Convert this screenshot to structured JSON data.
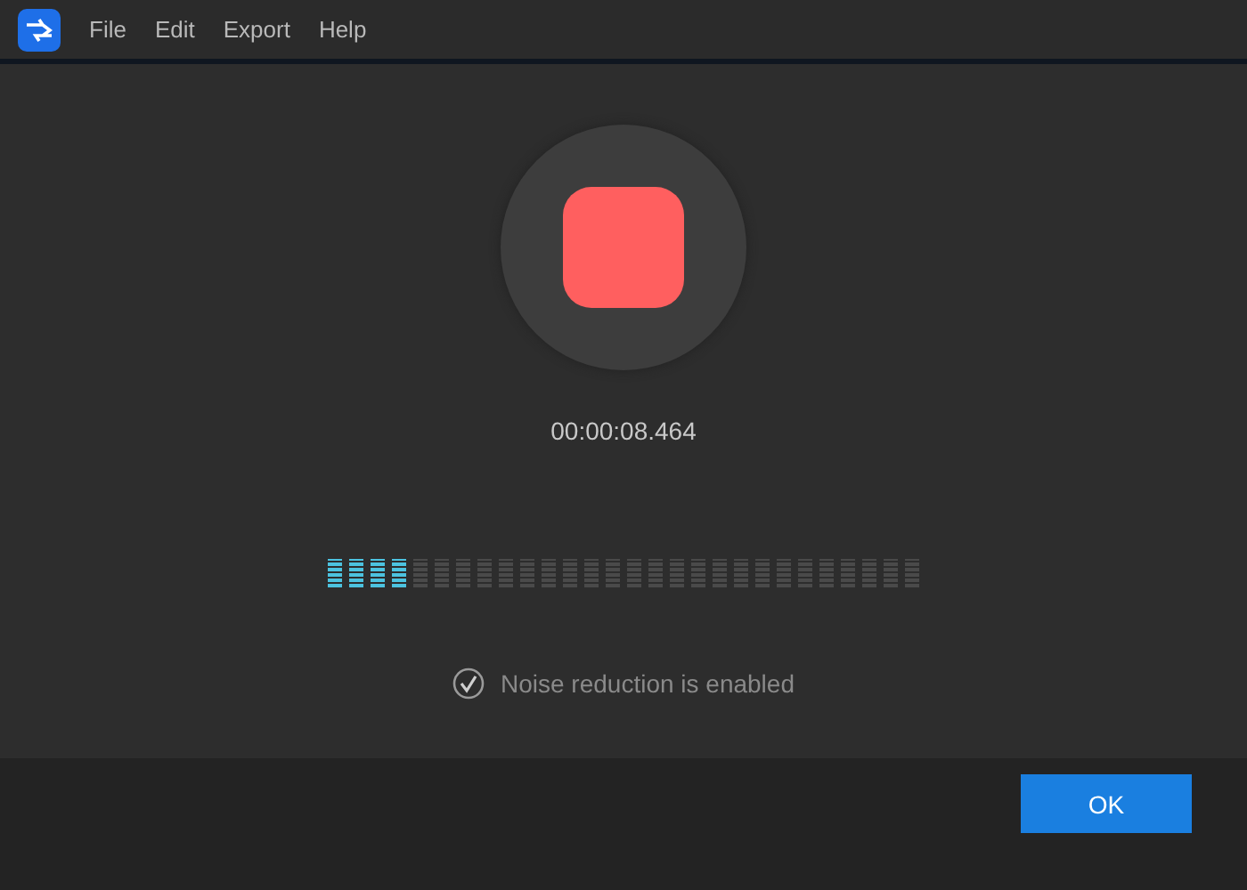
{
  "menu": [
    "File",
    "Edit",
    "Export",
    "Help"
  ],
  "recorder": {
    "recording": true,
    "time": "00:00:08.464"
  },
  "meter": {
    "level": 0.14
  },
  "noise_reduction": {
    "checked": true,
    "label": "Noise reduction is enabled"
  },
  "buttons": [
    "OK"
  ]
}
